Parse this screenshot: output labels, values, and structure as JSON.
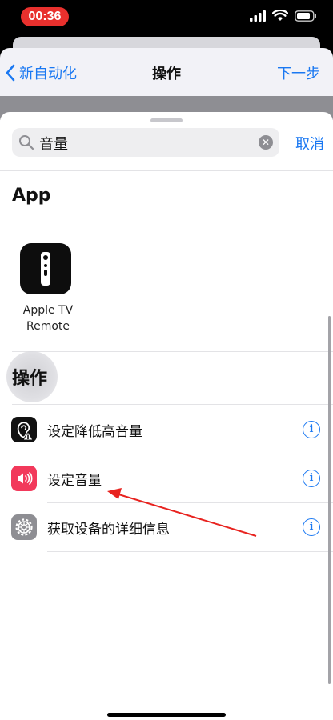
{
  "status_bar": {
    "time": "00:36",
    "time_pill_color": "#e8302d",
    "icons": [
      "cellular-signal-icon",
      "wifi-icon",
      "battery-icon"
    ]
  },
  "nav": {
    "back_label": "新自动化",
    "title": "操作",
    "next_label": "下一步",
    "accent_color": "#1a78f2"
  },
  "search": {
    "value": "音量",
    "cancel_label": "取消"
  },
  "apps_section": {
    "title": "App",
    "apps": [
      {
        "name_line1": "Apple TV",
        "name_line2": "Remote",
        "icon": "apple-tv-remote-icon"
      }
    ]
  },
  "actions_section": {
    "title": "操作",
    "items": [
      {
        "label": "设定降低高音量",
        "icon": "hearing-warning-icon",
        "icon_color": "#111111"
      },
      {
        "label": "设定音量",
        "icon": "speaker-volume-icon",
        "icon_color": "#f2395b"
      },
      {
        "label": "获取设备的详细信息",
        "icon": "settings-gear-icon",
        "icon_color": "#8e8e93"
      }
    ],
    "info_glyph": "i"
  },
  "annotation": {
    "arrow_color": "#e8231f",
    "points_to": "设定音量"
  }
}
